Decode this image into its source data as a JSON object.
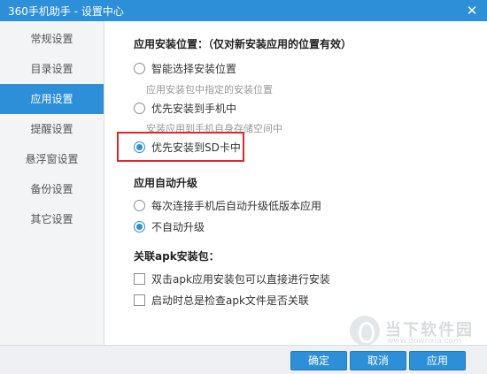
{
  "window": {
    "title": "360手机助手 - 设置中心",
    "close_icon": "close-icon",
    "accent_color": "#2d8fd8"
  },
  "sidebar": {
    "items": [
      {
        "label": "常规设置",
        "active": false
      },
      {
        "label": "目录设置",
        "active": false
      },
      {
        "label": "应用设置",
        "active": true
      },
      {
        "label": "提醒设置",
        "active": false
      },
      {
        "label": "悬浮窗设置",
        "active": false
      },
      {
        "label": "备份设置",
        "active": false
      },
      {
        "label": "其它设置",
        "active": false
      }
    ]
  },
  "content": {
    "install_location": {
      "title": "应用安装位置：（仅对新安装应用的位置有效）",
      "options": [
        {
          "label": "智能选择安装位置",
          "hint": "应用安装包中指定的安装位置",
          "selected": false
        },
        {
          "label": "优先安装到手机中",
          "hint": "安装应用到手机自身存储空间中",
          "selected": false
        },
        {
          "label": "优先安装到SD卡中",
          "selected": true
        }
      ]
    },
    "auto_upgrade": {
      "title": "应用自动升级",
      "options": [
        {
          "label": "每次连接手机后自动升级低版本应用",
          "selected": false
        },
        {
          "label": "不自动升级",
          "selected": true
        }
      ]
    },
    "apk_assoc": {
      "title": "关联apk安装包：",
      "options": [
        {
          "label": "双击apk应用安装包可以直接进行安装",
          "checked": false
        },
        {
          "label": "启动时总是检查apk文件是否关联",
          "checked": false
        }
      ]
    }
  },
  "footer": {
    "ok_label": "确定",
    "cancel_label": "取消",
    "apply_label": "应用"
  },
  "watermark": {
    "text": "当下软件园",
    "sub": "www.downxia.com"
  }
}
